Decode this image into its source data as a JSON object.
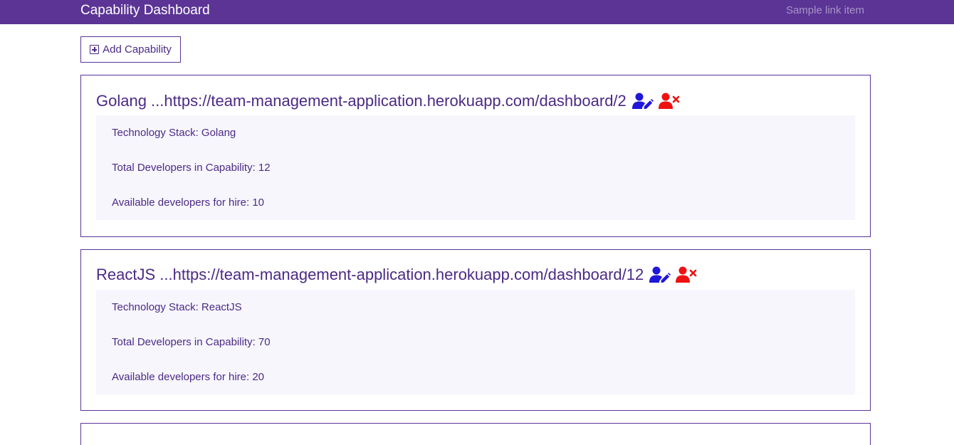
{
  "navbar": {
    "brand": "Capability Dashboard",
    "link": "Sample link item"
  },
  "add_button": {
    "label": "Add Capability",
    "icon": "plus-square-icon"
  },
  "colors": {
    "primary": "#5b3495",
    "text": "#4b2a85",
    "edit_icon": "#1f17d9",
    "remove_icon": "#ee1111",
    "card_body": "#f7f6fd"
  },
  "cards": [
    {
      "title": "Golang ...https://team-management-application.herokuapp.com/dashboard/2",
      "tech_stack": "Technology Stack: Golang",
      "total_devs": "Total Developers in Capability: 12",
      "available_devs": "Available developers for hire: 10"
    },
    {
      "title": "ReactJS ...https://team-management-application.herokuapp.com/dashboard/12",
      "tech_stack": "Technology Stack: ReactJS",
      "total_devs": "Total Developers in Capability: 70",
      "available_devs": "Available developers for hire: 20"
    }
  ]
}
